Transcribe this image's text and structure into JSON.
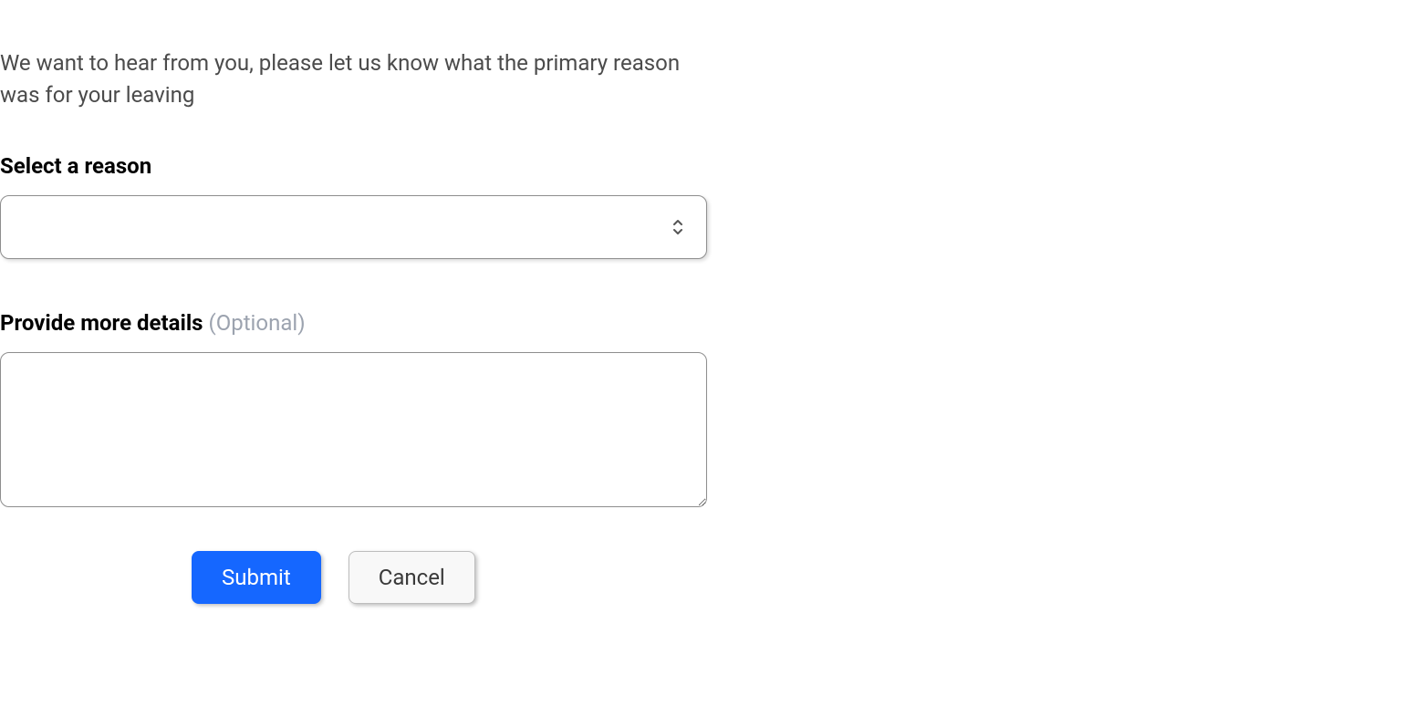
{
  "form": {
    "intro": "We want to hear from you, please let us know what the primary reason was for your leaving",
    "reason": {
      "label": "Select a reason",
      "value": ""
    },
    "details": {
      "label": "Provide more details ",
      "optional_hint": "(Optional)",
      "value": ""
    },
    "buttons": {
      "submit": "Submit",
      "cancel": "Cancel"
    }
  },
  "colors": {
    "primary": "#1567ff",
    "text_muted": "#4b4b4b",
    "hint": "#9ca3af",
    "border": "#8e8e8e"
  }
}
